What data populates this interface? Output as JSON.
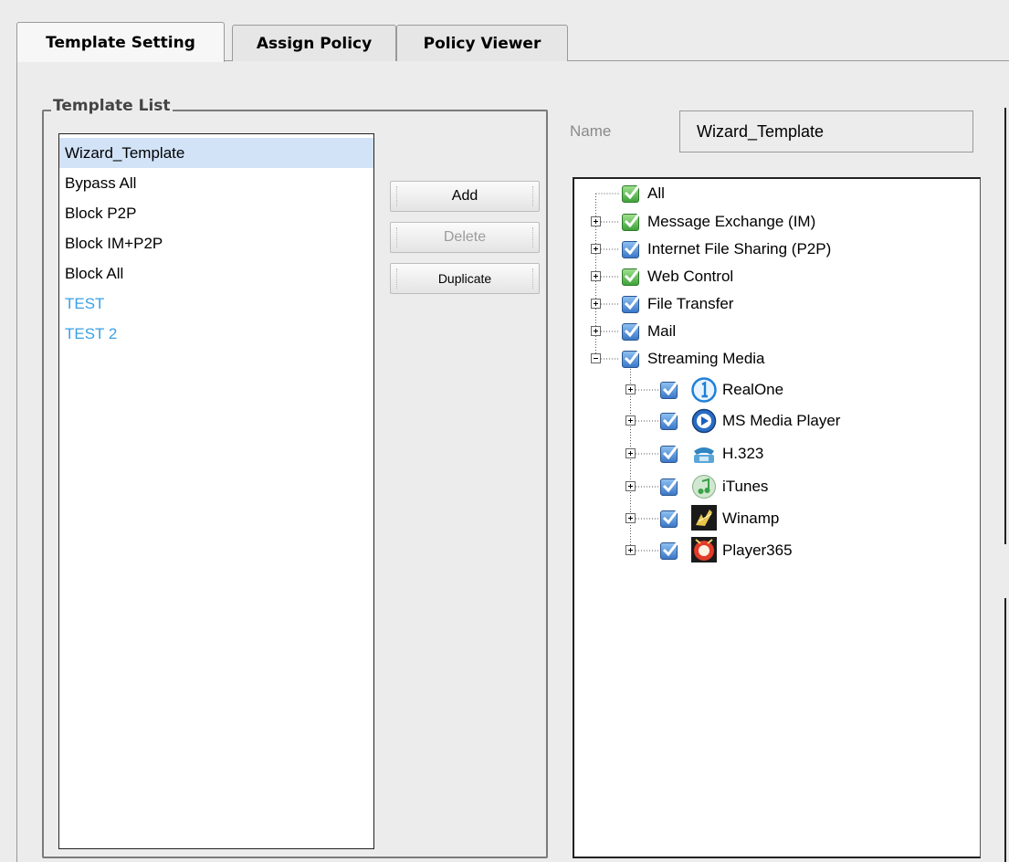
{
  "tabs": [
    {
      "label": "Template Setting",
      "active": true
    },
    {
      "label": "Assign Policy",
      "active": false
    },
    {
      "label": "Policy Viewer",
      "active": false
    }
  ],
  "template_list": {
    "title": "Template List",
    "items": [
      {
        "label": "Wizard_Template",
        "selected": true,
        "color": "#000000"
      },
      {
        "label": "Bypass All",
        "selected": false,
        "color": "#000000"
      },
      {
        "label": "Block P2P",
        "selected": false,
        "color": "#000000"
      },
      {
        "label": "Block IM+P2P",
        "selected": false,
        "color": "#000000"
      },
      {
        "label": "Block All",
        "selected": false,
        "color": "#000000"
      },
      {
        "label": "TEST",
        "selected": false,
        "color": "#3aa0e6"
      },
      {
        "label": "TEST 2",
        "selected": false,
        "color": "#3aa0e6"
      }
    ]
  },
  "buttons": {
    "add": "Add",
    "delete": "Delete",
    "duplicate": "Duplicate",
    "delete_enabled": false
  },
  "name_field": {
    "label": "Name",
    "value": "Wizard_Template"
  },
  "tree": {
    "nodes": [
      {
        "label": "All",
        "checked": true,
        "check_style": "green",
        "expander": "none"
      },
      {
        "label": "Message Exchange (IM)",
        "checked": true,
        "check_style": "green",
        "expander": "plus"
      },
      {
        "label": "Internet File Sharing (P2P)",
        "checked": true,
        "check_style": "blue",
        "expander": "plus"
      },
      {
        "label": "Web Control",
        "checked": true,
        "check_style": "green",
        "expander": "plus"
      },
      {
        "label": "File Transfer",
        "checked": true,
        "check_style": "blue",
        "expander": "plus"
      },
      {
        "label": "Mail",
        "checked": true,
        "check_style": "blue",
        "expander": "plus"
      },
      {
        "label": "Streaming Media",
        "checked": true,
        "check_style": "blue",
        "expander": "minus",
        "children": [
          {
            "label": "RealOne",
            "icon": "realone-icon",
            "checked": true
          },
          {
            "label": "MS Media Player",
            "icon": "media-player-icon",
            "checked": true
          },
          {
            "label": "H.323",
            "icon": "phone-icon",
            "checked": true
          },
          {
            "label": "iTunes",
            "icon": "itunes-icon",
            "checked": true
          },
          {
            "label": "Winamp",
            "icon": "winamp-icon",
            "checked": true
          },
          {
            "label": "Player365",
            "icon": "player365-icon",
            "checked": true
          }
        ]
      }
    ]
  },
  "colors": {
    "selection": "#d2e3f8",
    "user_template_text": "#3aa0e6",
    "check_green": "#3fa33a",
    "check_blue": "#3b78c8"
  }
}
